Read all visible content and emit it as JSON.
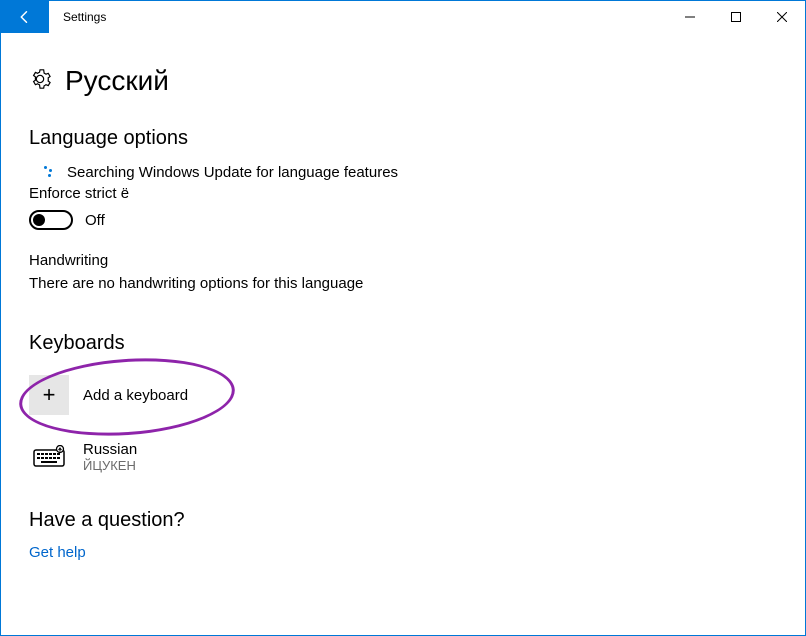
{
  "titlebar": {
    "app_title": "Settings"
  },
  "page": {
    "title": "Русский"
  },
  "language_options": {
    "heading": "Language options",
    "status": "Searching Windows Update for language features",
    "enforce_label": "Enforce strict ё",
    "toggle_state": "Off",
    "handwriting_label": "Handwriting",
    "handwriting_desc": "There are no handwriting options for this language"
  },
  "keyboards": {
    "heading": "Keyboards",
    "add_label": "Add a keyboard",
    "items": [
      {
        "name": "Russian",
        "layout": "ЙЦУКЕН"
      }
    ]
  },
  "help": {
    "heading": "Have a question?",
    "link": "Get help"
  }
}
